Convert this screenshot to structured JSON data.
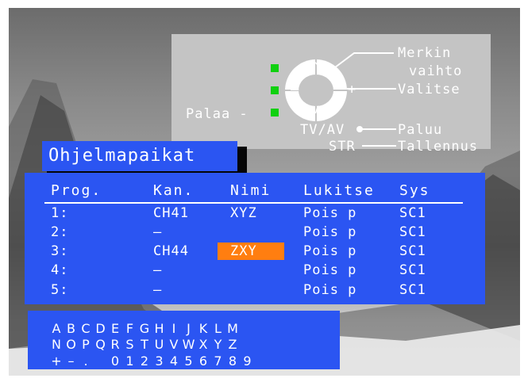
{
  "help": {
    "change_char_line1": "Merkin",
    "change_char_line2": "vaihto",
    "select": "Valitse",
    "back_left": "Palaa -",
    "tvav": "TV/AV",
    "return": "Paluu",
    "str": "STR",
    "store": "Tallennus",
    "arrow_up": "^",
    "arrow_down": "v",
    "minus": "–",
    "plus": "+"
  },
  "title": "Ohjelmapaikat",
  "table": {
    "headers": [
      "Prog.",
      "Kan.",
      "Nimi",
      "Lukitse",
      "Sys"
    ],
    "rows": [
      {
        "prog": "1:",
        "kan": "CH41",
        "nimi": "XYZ",
        "lukitse": "Pois p",
        "sys": "SC1"
      },
      {
        "prog": "2:",
        "kan": "–",
        "nimi": "",
        "lukitse": "Pois p",
        "sys": "SC1"
      },
      {
        "prog": "3:",
        "kan": "CH44",
        "nimi": "ZXY",
        "lukitse": "Pois p",
        "sys": "SC1"
      },
      {
        "prog": "4:",
        "kan": "–",
        "nimi": "",
        "lukitse": "Pois p",
        "sys": "SC1"
      },
      {
        "prog": "5:",
        "kan": "–",
        "nimi": "",
        "lukitse": "Pois p",
        "sys": "SC1"
      }
    ],
    "selected_name_row": 2
  },
  "chars": {
    "row1": [
      "A",
      "B",
      "C",
      "D",
      "E",
      "F",
      "G",
      "H",
      "I",
      "J",
      "K",
      "L",
      "M"
    ],
    "row2": [
      "N",
      "O",
      "P",
      "Q",
      "R",
      "S",
      "T",
      "U",
      "V",
      "W",
      "X",
      "Y",
      "Z"
    ],
    "row3": [
      "+",
      "–",
      ".",
      "",
      "0",
      "1",
      "2",
      "3",
      "4",
      "5",
      "6",
      "7",
      "8",
      "9"
    ]
  },
  "colors": {
    "menu_blue": "#2b55f2",
    "highlight_orange": "#ff7e10",
    "indicator_green": "#10d010",
    "panel_gray": "#c4c4c4"
  }
}
